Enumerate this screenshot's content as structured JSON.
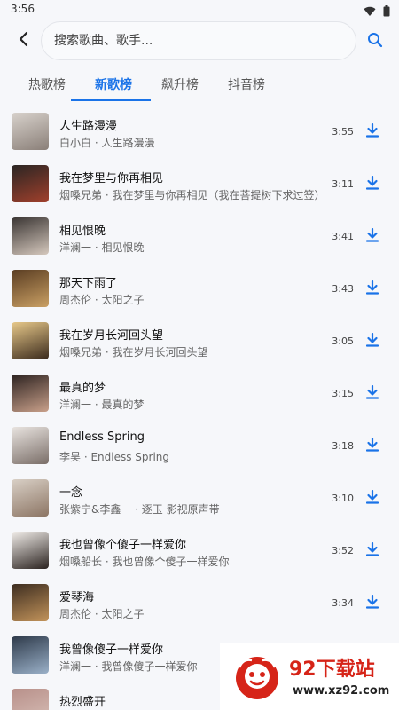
{
  "status_bar": {
    "time": "3:56",
    "icons": [
      "wifi-icon",
      "battery-icon"
    ]
  },
  "search": {
    "placeholder": "搜索歌曲、歌手...",
    "value": ""
  },
  "tabs": [
    {
      "label": "热歌榜",
      "active": false
    },
    {
      "label": "新歌榜",
      "active": true
    },
    {
      "label": "飙升榜",
      "active": false
    },
    {
      "label": "抖音榜",
      "active": false
    }
  ],
  "colors": {
    "accent": "#1a73e8",
    "background": "#f6f7fa",
    "watermark_red": "#d62418"
  },
  "songs": [
    {
      "title": "人生路漫漫",
      "subtitle": "白小白 · 人生路漫漫",
      "duration": "3:55",
      "cover_colors": [
        "#d8d2cc",
        "#8a7f78"
      ]
    },
    {
      "title": "我在梦里与你再相见",
      "subtitle": "烟嗓兄弟 · 我在梦里与你再相见（我在菩提树下求过签）",
      "duration": "3:11",
      "cover_colors": [
        "#2a2523",
        "#a1402c"
      ]
    },
    {
      "title": "相见恨晚",
      "subtitle": "洋澜一 · 相见恨晚",
      "duration": "3:41",
      "cover_colors": [
        "#3a3533",
        "#d5c8bd"
      ]
    },
    {
      "title": "那天下雨了",
      "subtitle": "周杰伦 · 太阳之子",
      "duration": "3:43",
      "cover_colors": [
        "#5a3d22",
        "#caa064"
      ]
    },
    {
      "title": "我在岁月长河回头望",
      "subtitle": "烟嗓兄弟 · 我在岁月长河回头望",
      "duration": "3:05",
      "cover_colors": [
        "#e8c98a",
        "#3a2a1c"
      ]
    },
    {
      "title": "最真的梦",
      "subtitle": "洋澜一 · 最真的梦",
      "duration": "3:15",
      "cover_colors": [
        "#2c2220",
        "#c9a08a"
      ]
    },
    {
      "title": "Endless Spring",
      "subtitle": "李昊 · Endless Spring",
      "duration": "3:18",
      "cover_colors": [
        "#e9e4e0",
        "#7a6e68"
      ]
    },
    {
      "title": "一念",
      "subtitle": "张紫宁&李鑫一 · 逐玉 影视原声带",
      "duration": "3:10",
      "cover_colors": [
        "#d9d0c6",
        "#8c7564"
      ]
    },
    {
      "title": "我也曾像个傻子一样爱你",
      "subtitle": "烟嗓船长 · 我也曾像个傻子一样爱你",
      "duration": "3:52",
      "cover_colors": [
        "#f2eeea",
        "#2b2320"
      ]
    },
    {
      "title": "爱琴海",
      "subtitle": "周杰伦 · 太阳之子",
      "duration": "3:34",
      "cover_colors": [
        "#3d2d20",
        "#c2935a"
      ]
    },
    {
      "title": "我曾像傻子一样爱你",
      "subtitle": "洋澜一 · 我曾像傻子一样爱你",
      "duration": "",
      "cover_colors": [
        "#2e3a4a",
        "#9ab0c8"
      ]
    },
    {
      "title": "热烈盛开",
      "subtitle": "",
      "duration": "",
      "cover_colors": [
        "#b8908a",
        "#d8c0b8"
      ]
    }
  ],
  "watermark": {
    "title": "92下载站",
    "url": "www.xz92.com"
  }
}
